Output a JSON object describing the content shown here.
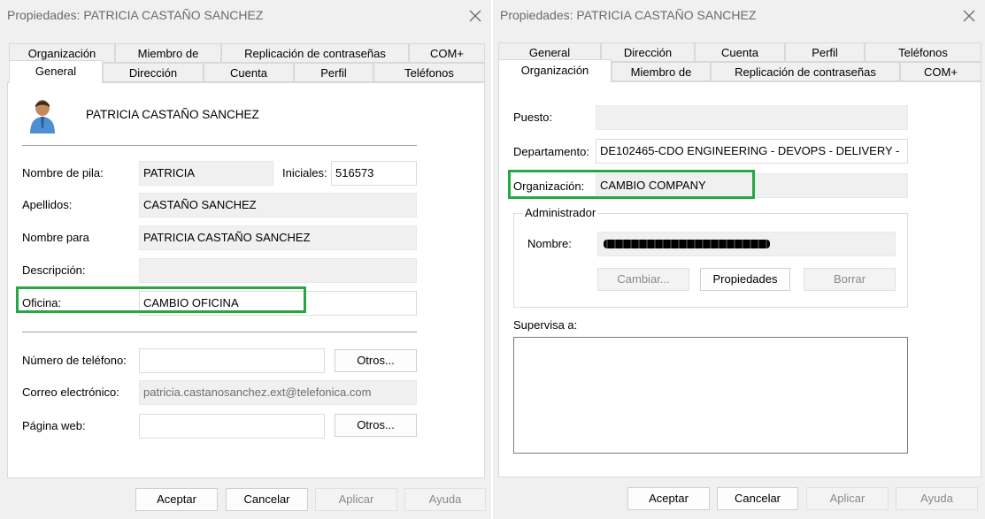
{
  "left": {
    "title": "Propiedades: PATRICIA CASTAÑO SANCHEZ",
    "tabs_row1": [
      "Organización",
      "Miembro de",
      "Replicación de contraseñas",
      "COM+"
    ],
    "tabs_row2": [
      "General",
      "Dirección",
      "Cuenta",
      "Perfil",
      "Teléfonos"
    ],
    "selected_tab": "General",
    "display_name": "PATRICIA CASTAÑO SANCHEZ",
    "first_name_label": "Nombre de pila:",
    "first_name": "PATRICIA",
    "initials_label": "Iniciales:",
    "initials": "516573",
    "last_name_label": "Apellidos:",
    "last_name": "CASTAÑO SANCHEZ",
    "display_label": "Nombre para",
    "display_value": "PATRICIA CASTAÑO SANCHEZ",
    "description_label": "Descripción:",
    "description": "",
    "office_label": "Oficina:",
    "office": "CAMBIO OFICINA",
    "phone_label": "Número de teléfono:",
    "phone": "",
    "phone_other": "Otros...",
    "email_label": "Correo electrónico:",
    "email": "patricia.castanosanchez.ext@telefonica.com",
    "web_label": "Página web:",
    "web": "",
    "web_other": "Otros...",
    "buttons": {
      "ok": "Aceptar",
      "cancel": "Cancelar",
      "apply": "Aplicar",
      "help": "Ayuda"
    }
  },
  "right": {
    "title": "Propiedades: PATRICIA CASTAÑO SANCHEZ",
    "tabs_row1": [
      "General",
      "Dirección",
      "Cuenta",
      "Perfil",
      "Teléfonos"
    ],
    "tabs_row2": [
      "Organización",
      "Miembro de",
      "Replicación de contraseñas",
      "COM+"
    ],
    "selected_tab": "Organización",
    "job_label": "Puesto:",
    "job": "",
    "dept_label": "Departamento:",
    "dept": "DE102465-CDO ENGINEERING - DEVOPS - DELIVERY -",
    "org_label": "Organización:",
    "org": "CAMBIO COMPANY",
    "manager_group": "Administrador",
    "manager_name_label": "Nombre:",
    "manager_buttons": {
      "change": "Cambiar...",
      "properties": "Propiedades",
      "clear": "Borrar"
    },
    "reports_label": "Supervisa a:",
    "buttons": {
      "ok": "Aceptar",
      "cancel": "Cancelar",
      "apply": "Aplicar",
      "help": "Ayuda"
    }
  },
  "colors": {
    "highlight": "#27a744",
    "dialog_bg": "#f0f0f0",
    "panel_bg": "#ffffff"
  }
}
